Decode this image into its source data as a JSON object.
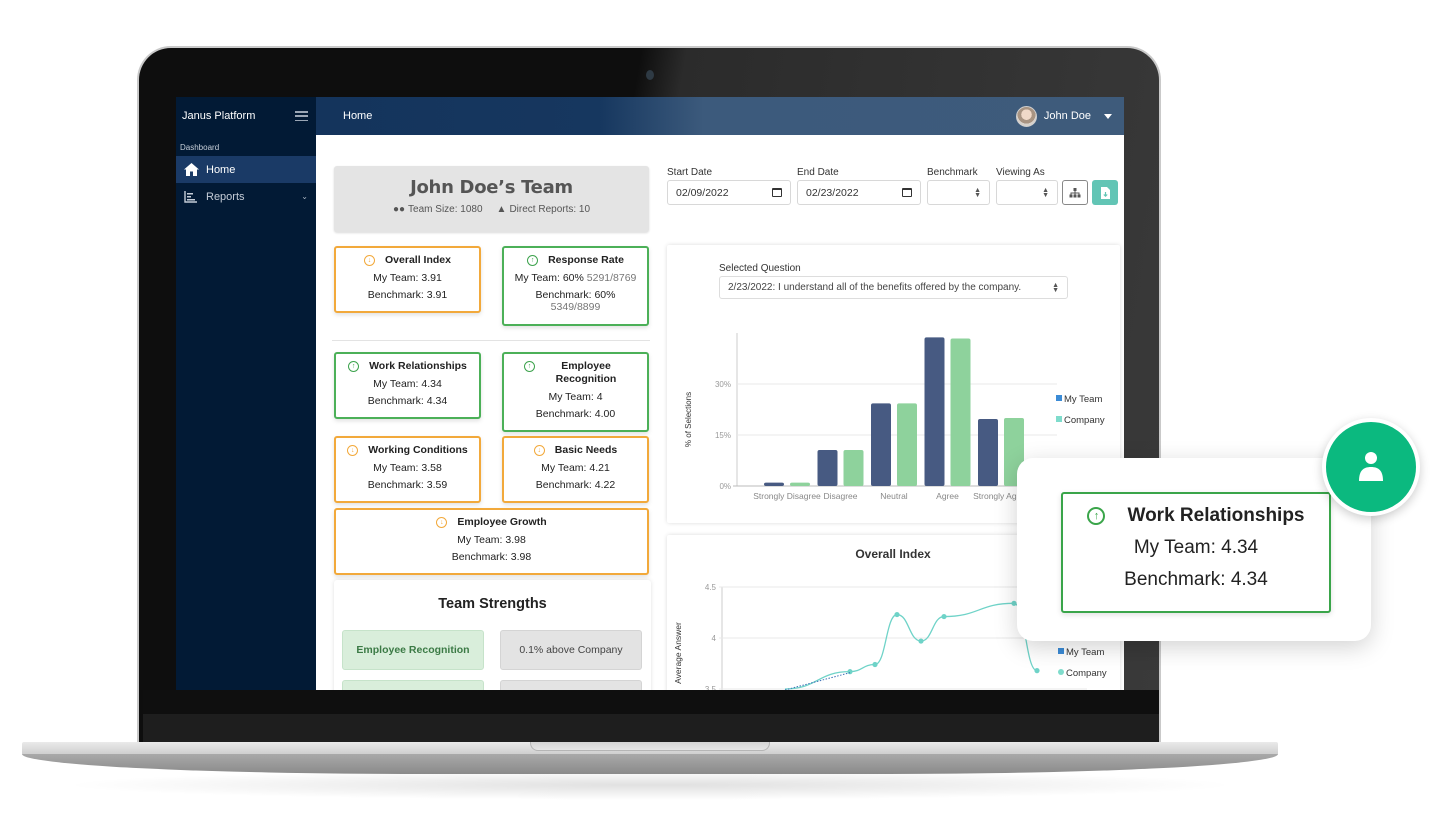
{
  "app": {
    "brand": "Janus Platform",
    "page_title": "Home",
    "user_name": "John Doe"
  },
  "sidebar": {
    "section": "Dashboard",
    "items": [
      {
        "label": "Home",
        "icon": "home-icon",
        "active": true
      },
      {
        "label": "Reports",
        "icon": "reports-icon",
        "active": false,
        "expandable": true
      }
    ]
  },
  "team": {
    "title": "John Doe’s Team",
    "team_size": "Team Size: 1080",
    "direct_reports": "Direct Reports: 10"
  },
  "metrics": [
    {
      "title": "Overall Index",
      "trend": "down",
      "my_team": "My Team: 3.91",
      "benchmark": "Benchmark: 3.91"
    },
    {
      "title": "Response Rate",
      "trend": "up",
      "my_team": "My Team: 60%",
      "my_team_detail": "5291/8769",
      "benchmark": "Benchmark: 60%",
      "benchmark_detail": "5349/8899"
    },
    {
      "title": "Work Relationships",
      "trend": "up",
      "my_team": "My Team: 4.34",
      "benchmark": "Benchmark: 4.34"
    },
    {
      "title": "Employee Recognition",
      "trend": "up",
      "my_team": "My Team: 4",
      "benchmark": "Benchmark: 4.00"
    },
    {
      "title": "Working Conditions",
      "trend": "down",
      "my_team": "My Team: 3.58",
      "benchmark": "Benchmark: 3.59"
    },
    {
      "title": "Basic Needs",
      "trend": "down",
      "my_team": "My Team: 4.21",
      "benchmark": "Benchmark: 4.22"
    },
    {
      "title": "Employee Growth",
      "trend": "down",
      "my_team": "My Team: 3.98",
      "benchmark": "Benchmark: 3.98"
    }
  ],
  "strengths": {
    "title": "Team Strengths",
    "rows": [
      {
        "name": "Employee Recognition",
        "delta": "0.1% above Company"
      }
    ]
  },
  "filters": {
    "start_date_label": "Start Date",
    "start_date": "02/09/2022",
    "end_date_label": "End Date",
    "end_date": "02/23/2022",
    "benchmark_label": "Benchmark",
    "benchmark_value": "",
    "viewing_as_label": "Viewing As",
    "viewing_as_value": ""
  },
  "question": {
    "label": "Selected Question",
    "value": "2/23/2022: I understand all of the benefits offered by the company."
  },
  "colors": {
    "my_team_bar": "#475a82",
    "company_bar": "#8ed29c",
    "legend_my_team": "#3b8bd6",
    "legend_company": "#7fdccc",
    "line_company": "#6fd3c8",
    "up": "#4cb058",
    "down": "#f2a93b",
    "popout_avatar": "#0bb97f"
  },
  "chart_data": [
    {
      "type": "bar",
      "title": "",
      "xlabel": "",
      "ylabel": "% of Selections",
      "categories": [
        "Strongly Disagree",
        "Disagree",
        "Neutral",
        "Agree",
        "Strongly Agree"
      ],
      "series": [
        {
          "name": "My Team",
          "values": [
            1.0,
            10.6,
            24.3,
            43.7,
            19.7
          ]
        },
        {
          "name": "Company",
          "values": [
            1.0,
            10.6,
            24.3,
            43.4,
            20.0
          ]
        }
      ],
      "yticks": [
        "0%",
        "15%",
        "30%"
      ],
      "ylim": [
        0,
        45
      ],
      "grid": true,
      "legend": "right"
    },
    {
      "type": "line",
      "title": "Overall Index",
      "xlabel": "",
      "ylabel": "Average Answer",
      "yticks": [
        "3.5",
        "4",
        "4.5"
      ],
      "ylim": [
        3.5,
        4.5
      ],
      "series": [
        {
          "name": "My Team",
          "values": [
            3.5,
            3.67
          ]
        },
        {
          "name": "Company",
          "values": [
            3.5,
            3.67,
            3.74,
            4.23,
            3.97,
            4.21,
            4.34,
            3.68
          ]
        }
      ],
      "grid": true,
      "legend": "right"
    }
  ],
  "popout": {
    "title": "Work Relationships",
    "trend": "up",
    "my_team": "My Team: 4.34",
    "benchmark": "Benchmark: 4.34"
  }
}
